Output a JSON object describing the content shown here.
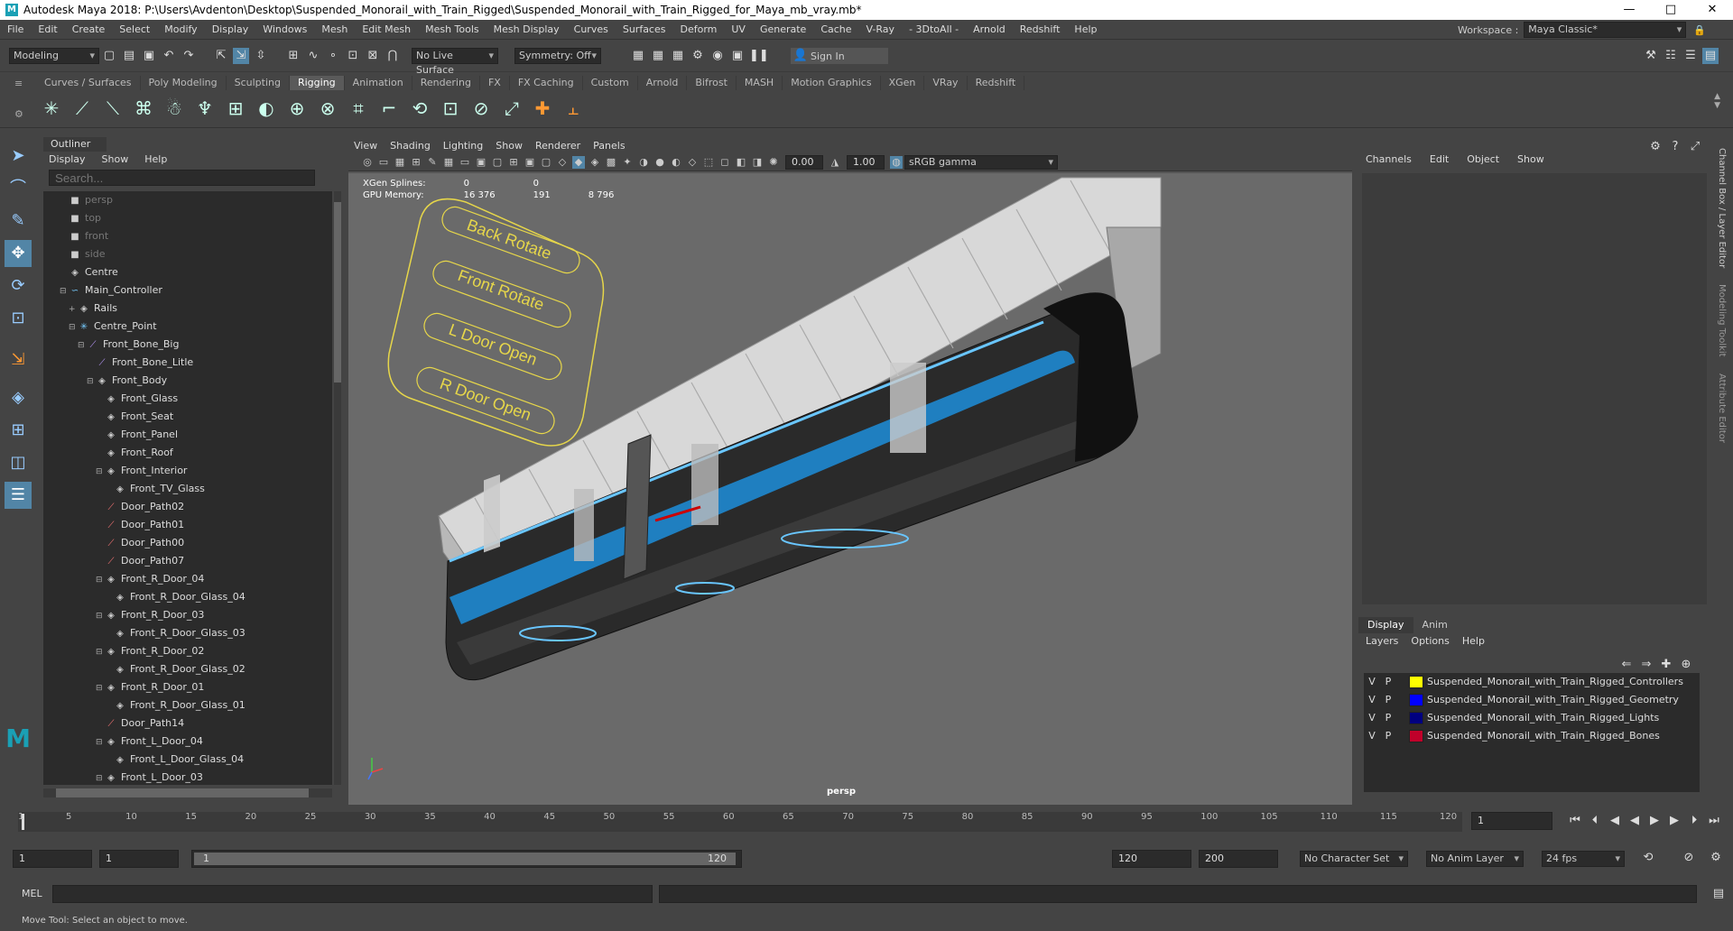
{
  "window": {
    "title": "Autodesk Maya 2018: P:\\Users\\Avdenton\\Desktop\\Suspended_Monorail_with_Train_Rigged\\Suspended_Monorail_with_Train_Rigged_for_Maya_mb_vray.mb*",
    "minimize": "—",
    "maximize": "□",
    "close": "✕"
  },
  "menubar": {
    "items": [
      "File",
      "Edit",
      "Create",
      "Select",
      "Modify",
      "Display",
      "Windows",
      "Mesh",
      "Edit Mesh",
      "Mesh Tools",
      "Mesh Display",
      "Curves",
      "Surfaces",
      "Deform",
      "UV",
      "Generate",
      "Cache",
      "V-Ray",
      "- 3DtoAll -",
      "Arnold",
      "Redshift",
      "Help"
    ],
    "workspace_label": "Workspace :",
    "workspace_value": "Maya Classic*"
  },
  "status": {
    "mode": "Modeling",
    "live_surface": "No Live Surface",
    "symmetry": "Symmetry: Off",
    "sign_in": "Sign In"
  },
  "shelf": {
    "tabs": [
      "Curves / Surfaces",
      "Poly Modeling",
      "Sculpting",
      "Rigging",
      "Animation",
      "Rendering",
      "FX",
      "FX Caching",
      "Custom",
      "Arnold",
      "Bifrost",
      "MASH",
      "Motion Graphics",
      "XGen",
      "VRay",
      "Redshift"
    ],
    "active": "Rigging"
  },
  "outliner": {
    "title": "Outliner",
    "menu": [
      "Display",
      "Show",
      "Help"
    ],
    "search_placeholder": "Search...",
    "items": [
      {
        "label": "persp",
        "indent": 1,
        "icon": "camera-icon",
        "dim": true
      },
      {
        "label": "top",
        "indent": 1,
        "icon": "camera-icon",
        "dim": true
      },
      {
        "label": "front",
        "indent": 1,
        "icon": "camera-icon",
        "dim": true
      },
      {
        "label": "side",
        "indent": 1,
        "icon": "camera-icon",
        "dim": true
      },
      {
        "label": "Centre",
        "indent": 1,
        "icon": "transform-icon"
      },
      {
        "label": "Main_Controller",
        "indent": 1,
        "icon": "curve-icon",
        "exp": "⊟"
      },
      {
        "label": "Rails",
        "indent": 2,
        "icon": "transform-icon",
        "exp": "+"
      },
      {
        "label": "Centre_Point",
        "indent": 2,
        "icon": "joint-icon",
        "exp": "⊟"
      },
      {
        "label": "Front_Bone_Big",
        "indent": 3,
        "icon": "bone-icon",
        "exp": "⊟"
      },
      {
        "label": "Front_Bone_Litle",
        "indent": 4,
        "icon": "bone-icon"
      },
      {
        "label": "Front_Body",
        "indent": 4,
        "icon": "transform-icon",
        "exp": "⊟"
      },
      {
        "label": "Front_Glass",
        "indent": 5,
        "icon": "transform-icon"
      },
      {
        "label": "Front_Seat",
        "indent": 5,
        "icon": "transform-icon"
      },
      {
        "label": "Front_Panel",
        "indent": 5,
        "icon": "transform-icon"
      },
      {
        "label": "Front_Roof",
        "indent": 5,
        "icon": "transform-icon"
      },
      {
        "label": "Front_Interior",
        "indent": 5,
        "icon": "transform-icon",
        "exp": "⊟"
      },
      {
        "label": "Front_TV_Glass",
        "indent": 6,
        "icon": "transform-icon"
      },
      {
        "label": "Door_Path02",
        "indent": 5,
        "icon": "path-icon"
      },
      {
        "label": "Door_Path01",
        "indent": 5,
        "icon": "path-icon"
      },
      {
        "label": "Door_Path00",
        "indent": 5,
        "icon": "path-icon"
      },
      {
        "label": "Door_Path07",
        "indent": 5,
        "icon": "path-icon"
      },
      {
        "label": "Front_R_Door_04",
        "indent": 5,
        "icon": "transform-icon",
        "exp": "⊟"
      },
      {
        "label": "Front_R_Door_Glass_04",
        "indent": 6,
        "icon": "transform-icon"
      },
      {
        "label": "Front_R_Door_03",
        "indent": 5,
        "icon": "transform-icon",
        "exp": "⊟"
      },
      {
        "label": "Front_R_Door_Glass_03",
        "indent": 6,
        "icon": "transform-icon"
      },
      {
        "label": "Front_R_Door_02",
        "indent": 5,
        "icon": "transform-icon",
        "exp": "⊟"
      },
      {
        "label": "Front_R_Door_Glass_02",
        "indent": 6,
        "icon": "transform-icon"
      },
      {
        "label": "Front_R_Door_01",
        "indent": 5,
        "icon": "transform-icon",
        "exp": "⊟"
      },
      {
        "label": "Front_R_Door_Glass_01",
        "indent": 6,
        "icon": "transform-icon"
      },
      {
        "label": "Door_Path14",
        "indent": 5,
        "icon": "path-icon"
      },
      {
        "label": "Front_L_Door_04",
        "indent": 5,
        "icon": "transform-icon",
        "exp": "⊟"
      },
      {
        "label": "Front_L_Door_Glass_04",
        "indent": 6,
        "icon": "transform-icon"
      },
      {
        "label": "Front_L_Door_03",
        "indent": 5,
        "icon": "transform-icon",
        "exp": "⊟"
      }
    ]
  },
  "viewport": {
    "menu": [
      "View",
      "Shading",
      "Lighting",
      "Show",
      "Renderer",
      "Panels"
    ],
    "field1": "0.00",
    "field2": "1.00",
    "color_space": "sRGB gamma",
    "camera_label": "persp",
    "hud": {
      "xgen_label": "XGen Splines:",
      "xgen_v1": "0",
      "xgen_v2": "0",
      "gpu_label": "GPU Memory:",
      "gpu_v1": "16 376",
      "gpu_v2": "191",
      "gpu_v3": "8 796"
    },
    "controls": [
      "Back Rotate",
      "Front Rotate",
      "L Door Open",
      "R Door Open"
    ]
  },
  "channelbox": {
    "menu": [
      "Channels",
      "Edit",
      "Object",
      "Show"
    ],
    "side_tabs": [
      "Channel Box / Layer Editor",
      "Modeling Toolkit",
      "Attribute Editor"
    ]
  },
  "layers": {
    "tabs": [
      "Display",
      "Anim"
    ],
    "menu": [
      "Layers",
      "Options",
      "Help"
    ],
    "rows": [
      {
        "v": "V",
        "p": "P",
        "color": "#ffff00",
        "name": "Suspended_Monorail_with_Train_Rigged_Controllers"
      },
      {
        "v": "V",
        "p": "P",
        "color": "#0000ff",
        "name": "Suspended_Monorail_with_Train_Rigged_Geometry"
      },
      {
        "v": "V",
        "p": "P",
        "color": "#000080",
        "name": "Suspended_Monorail_with_Train_Rigged_Lights"
      },
      {
        "v": "V",
        "p": "P",
        "color": "#c0002a",
        "name": "Suspended_Monorail_with_Train_Rigged_Bones"
      }
    ]
  },
  "timeline": {
    "ticks": [
      "1",
      "5",
      "10",
      "15",
      "20",
      "25",
      "30",
      "35",
      "40",
      "45",
      "50",
      "55",
      "60",
      "65",
      "70",
      "75",
      "80",
      "85",
      "90",
      "95",
      "100",
      "105",
      "110",
      "115",
      "120"
    ],
    "current_frame": "1"
  },
  "range": {
    "start": "1",
    "start2": "1",
    "slider_start": "1",
    "slider_end": "120",
    "end": "120",
    "end2": "200",
    "character_set": "No Character Set",
    "anim_layer": "No Anim Layer",
    "fps": "24 fps"
  },
  "cmd": {
    "label": "MEL"
  },
  "help": {
    "text": "Move Tool: Select an object to move."
  }
}
